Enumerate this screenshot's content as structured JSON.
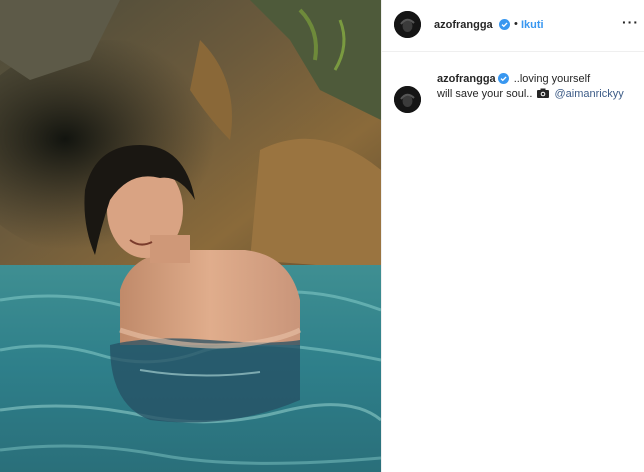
{
  "header": {
    "username": "azofrangga",
    "separator": "•",
    "follow_label": "Ikuti",
    "more_label": "···"
  },
  "caption": {
    "username": "azofrangga",
    "text_line1": " ..loving yourself",
    "text_line2": "will save your soul..",
    "mention": "@aimanrickyy"
  },
  "colors": {
    "accent": "#3897f0",
    "verified": "#3897f0",
    "mention": "#3d5c87",
    "text": "#262626"
  },
  "icons": {
    "verified": "verified-badge-icon",
    "camera": "camera-icon",
    "more": "more-options-icon"
  }
}
